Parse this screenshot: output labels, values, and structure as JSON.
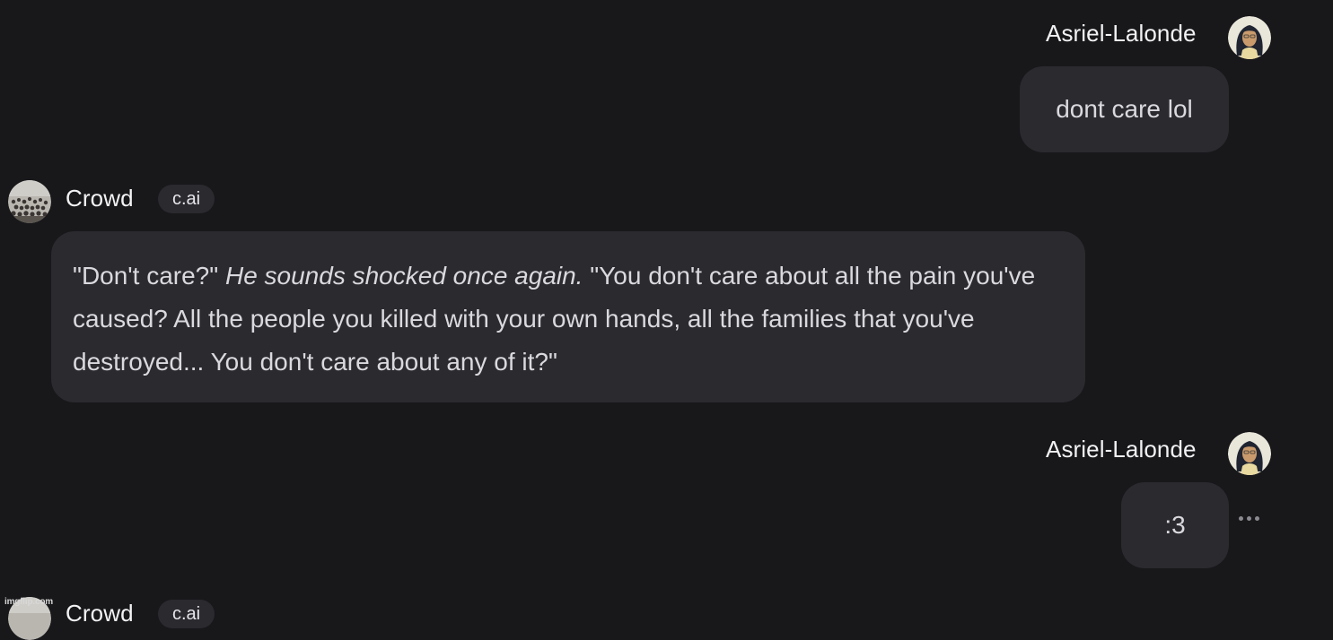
{
  "messages": [
    {
      "role": "user",
      "author": "Asriel-Lalonde",
      "avatar_icon": "user-avatar-icon",
      "text": "dont care lol"
    },
    {
      "role": "bot",
      "author": "Crowd",
      "badge": "c.ai",
      "avatar_icon": "crowd-avatar-icon",
      "text_parts": [
        "\"Don't care?\" ",
        "He sounds shocked once again.",
        " \"You don't care about all the pain you've caused? All the people you killed with your own hands, all the families that you've destroyed... You don't care about any of it?\""
      ]
    },
    {
      "role": "user",
      "author": "Asriel-Lalonde",
      "avatar_icon": "user-avatar-icon",
      "text": ":3",
      "menu_icon": "more-options-icon"
    },
    {
      "role": "bot",
      "author": "Crowd",
      "badge": "c.ai",
      "avatar_icon": "crowd-avatar-icon"
    }
  ],
  "watermark": "imgflip.com",
  "colors": {
    "background": "#18181b",
    "bubble": "#2a2a2f",
    "text": "#d9d9de",
    "name": "#f2f2f4"
  }
}
